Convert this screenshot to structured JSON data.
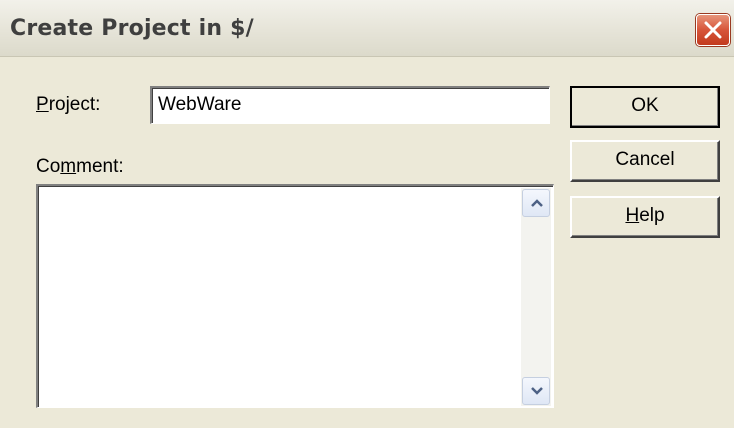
{
  "window": {
    "title": "Create Project in $/"
  },
  "form": {
    "project_label_accel": "P",
    "project_label_rest": "roject:",
    "project_value": "WebWare",
    "comment_label_pre": "Co",
    "comment_label_accel": "m",
    "comment_label_post": "ment:",
    "comment_value": ""
  },
  "buttons": {
    "ok_label": "OK",
    "cancel_label": "Cancel",
    "help_accel": "H",
    "help_rest": "elp"
  },
  "icons": {
    "close": "close-icon",
    "scroll_up": "arrow-up-icon",
    "scroll_down": "arrow-down-icon"
  },
  "colors": {
    "dialog_face": "#ece9d8",
    "close_button": "#d7553a"
  }
}
